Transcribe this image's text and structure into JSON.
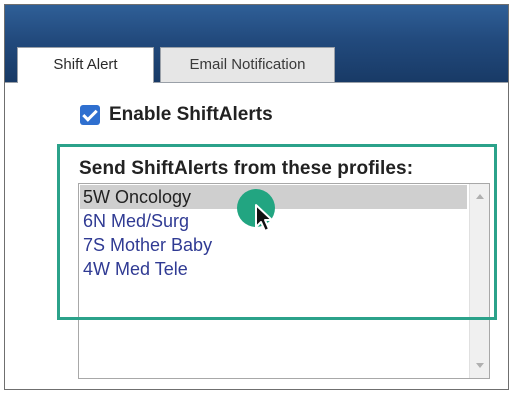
{
  "tabs": [
    {
      "label": "Shift Alert",
      "active": true
    },
    {
      "label": "Email Notification",
      "active": false
    }
  ],
  "enable": {
    "label": "Enable ShiftAlerts",
    "checked": true
  },
  "profiles": {
    "label": "Send ShiftAlerts from these profiles:",
    "items": [
      {
        "label": "5W Oncology",
        "selected": true
      },
      {
        "label": "6N Med/Surg",
        "selected": false
      },
      {
        "label": "7S Mother Baby",
        "selected": false
      },
      {
        "label": "4W Med Tele",
        "selected": false
      }
    ]
  },
  "colors": {
    "highlight": "#2ba28a",
    "click_indicator": "#22a581",
    "checkbox": "#2f6fcf",
    "item_text": "#2f3a93"
  },
  "icons": {
    "cursor": "arrow-cursor-icon",
    "checkbox": "checkmark-icon"
  }
}
